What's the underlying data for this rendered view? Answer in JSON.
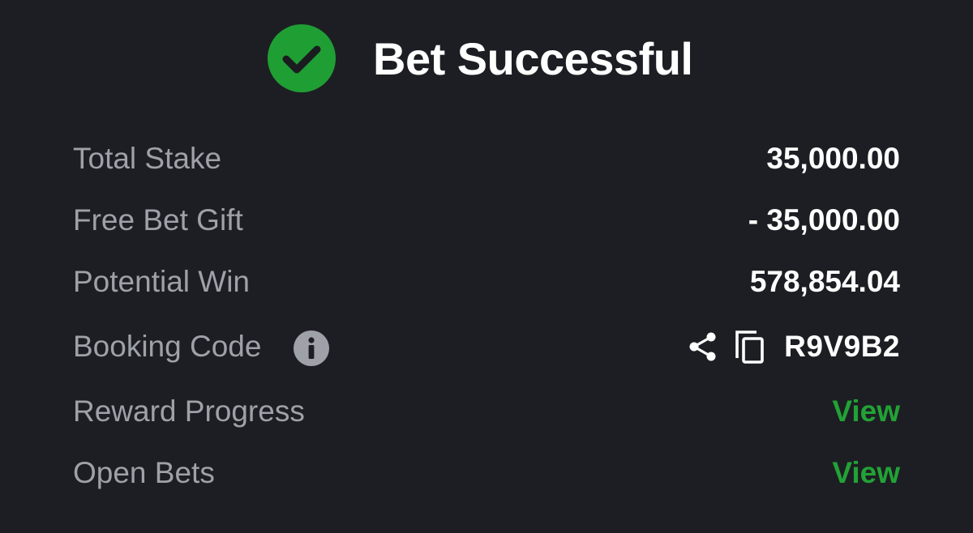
{
  "header": {
    "status_icon": "check-circle-icon",
    "title": "Bet Successful",
    "accent_color": "#1f9e34"
  },
  "rows": {
    "total_stake": {
      "label": "Total Stake",
      "value": "35,000.00"
    },
    "free_bet_gift": {
      "label": "Free Bet Gift",
      "value": "- 35,000.00"
    },
    "potential_win": {
      "label": "Potential Win",
      "value": "578,854.04"
    },
    "booking_code": {
      "label": "Booking Code",
      "info_icon": "info-icon",
      "share_icon": "share-icon",
      "copy_icon": "copy-icon",
      "value": "R9V9B2"
    },
    "reward_progress": {
      "label": "Reward Progress",
      "link": "View"
    },
    "open_bets": {
      "label": "Open Bets",
      "link": "View"
    }
  },
  "colors": {
    "background": "#1d1e23",
    "label": "#9fa1a9",
    "value": "#ffffff",
    "link": "#22a236"
  }
}
